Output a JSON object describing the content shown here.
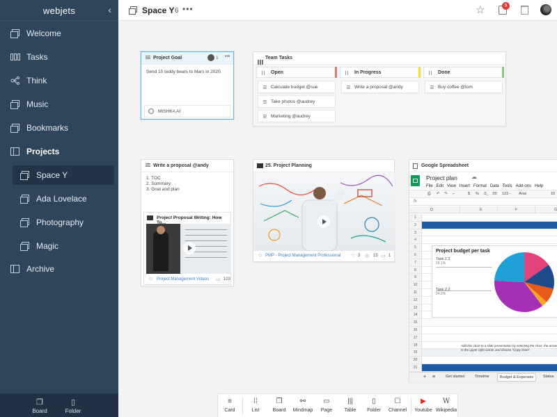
{
  "sidebar": {
    "title": "webjets",
    "collapse_icon": "‹",
    "items": [
      {
        "label": "Welcome",
        "icon": "card-icon"
      },
      {
        "label": "Tasks",
        "icon": "columns-icon"
      },
      {
        "label": "Think",
        "icon": "mindmap-icon"
      },
      {
        "label": "Music",
        "icon": "card-icon"
      },
      {
        "label": "Bookmarks",
        "icon": "card-icon"
      },
      {
        "label": "Projects",
        "icon": "board-icon"
      },
      {
        "label": "Space Y",
        "icon": "card-icon"
      },
      {
        "label": "Ada Lovelace",
        "icon": "card-icon"
      },
      {
        "label": "Photography",
        "icon": "card-icon"
      },
      {
        "label": "Magic",
        "icon": "card-icon"
      },
      {
        "label": "Archive",
        "icon": "board-icon"
      }
    ],
    "bottom": {
      "board_label": "Board",
      "folder_label": "Folder"
    }
  },
  "topbar": {
    "title": "Space Y",
    "count": "6",
    "more": "•••",
    "notification_count": "9"
  },
  "project_goal": {
    "title": "Project Goal",
    "count": "1",
    "more": "•••",
    "body": "Send 10 teddy bears to Mars in 2020.",
    "footer": "MISHKA AI"
  },
  "team_tasks": {
    "title": "Team Tasks",
    "columns": [
      {
        "label": "Open",
        "color": "#e57373",
        "tasks": [
          "Calculate budget @sue",
          "Take photos @audrey",
          "Marketing @audrey"
        ]
      },
      {
        "label": "In Progress",
        "color": "#fdd835",
        "tasks": [
          "Write a proposal @andy"
        ]
      },
      {
        "label": "Done",
        "color": "#81c784",
        "tasks": [
          "Buy coffee @tom"
        ]
      }
    ]
  },
  "proposal": {
    "title": "Write a proposal @andy",
    "lines": [
      "1. TOC",
      "2. Summary",
      "3. Goal and plan"
    ],
    "video_title": "Project Proposal Writing: How To...",
    "channel": "Project Management Videos",
    "comments": "103"
  },
  "planning": {
    "title": "25. Project Planning",
    "source": "PMP - Project Management Professional",
    "stat_a": "3",
    "stat_b": "15",
    "stat_c": "1"
  },
  "spreadsheet": {
    "title": "Google Spreadsheet",
    "doc_title": "Project plan",
    "menu": [
      "File",
      "Edit",
      "View",
      "Insert",
      "Format",
      "Data",
      "Tools",
      "Add-ons",
      "Help"
    ],
    "toolbar_font": "Arial",
    "toolbar_size": "10",
    "toolbar_zoom": "123 -",
    "toolbar_currency": "$",
    "toolbar_percent": "%",
    "toolbar_decimal": ".0_",
    "toolbar_decimal2": ".00",
    "fx": "fx",
    "columns": [
      "D",
      "E",
      "F",
      "G"
    ],
    "rows": [
      "1",
      "2",
      "3",
      "4",
      "5",
      "6",
      "7",
      "8",
      "9",
      "10",
      "11",
      "12",
      "13",
      "14",
      "15",
      "16",
      "17",
      "18",
      "19",
      "20",
      "21",
      "22",
      "23"
    ],
    "chart_title": "Project budget per task",
    "label_a": "Task 2.3",
    "label_a_val": "15.1%",
    "label_b": "Task 2.2",
    "label_b_val": "24.2%",
    "note": "Add this chart to a slide presentation by selecting the chart, the arrow in the upper right corner and choose \"Copy chart\".",
    "tabs": [
      "Get started",
      "Timeline",
      "Budget & Expenses",
      "Status"
    ]
  },
  "chart_data": {
    "type": "pie",
    "title": "Project budget per task",
    "slices": [
      {
        "label": "Task 2.3",
        "value": 15.1,
        "color": "#e4427b"
      },
      {
        "label": "",
        "value": 13.5,
        "color": "#1e4a8c"
      },
      {
        "label": "",
        "value": 8.0,
        "color": "#e8591a"
      },
      {
        "label": "",
        "value": 3.0,
        "color": "#f5a623"
      },
      {
        "label": "",
        "value": 36.2,
        "color": "#a52fb5"
      },
      {
        "label": "Task 2.2",
        "value": 24.2,
        "color": "#1fa0d6"
      }
    ]
  },
  "bottombar": {
    "items": [
      {
        "label": "Card",
        "glyph": "≡"
      },
      {
        "label": "List",
        "glyph": "⁞⁞"
      },
      {
        "label": "Board",
        "glyph": "❐"
      },
      {
        "label": "Mindmap",
        "glyph": "⚯"
      },
      {
        "label": "Page",
        "glyph": "▭"
      },
      {
        "label": "Table",
        "glyph": "|||"
      },
      {
        "label": "Folder",
        "glyph": "▯"
      },
      {
        "label": "Channel",
        "glyph": "☐"
      },
      {
        "label": "Youtube",
        "glyph": "▶"
      },
      {
        "label": "Wikipedia",
        "glyph": "W"
      }
    ]
  }
}
